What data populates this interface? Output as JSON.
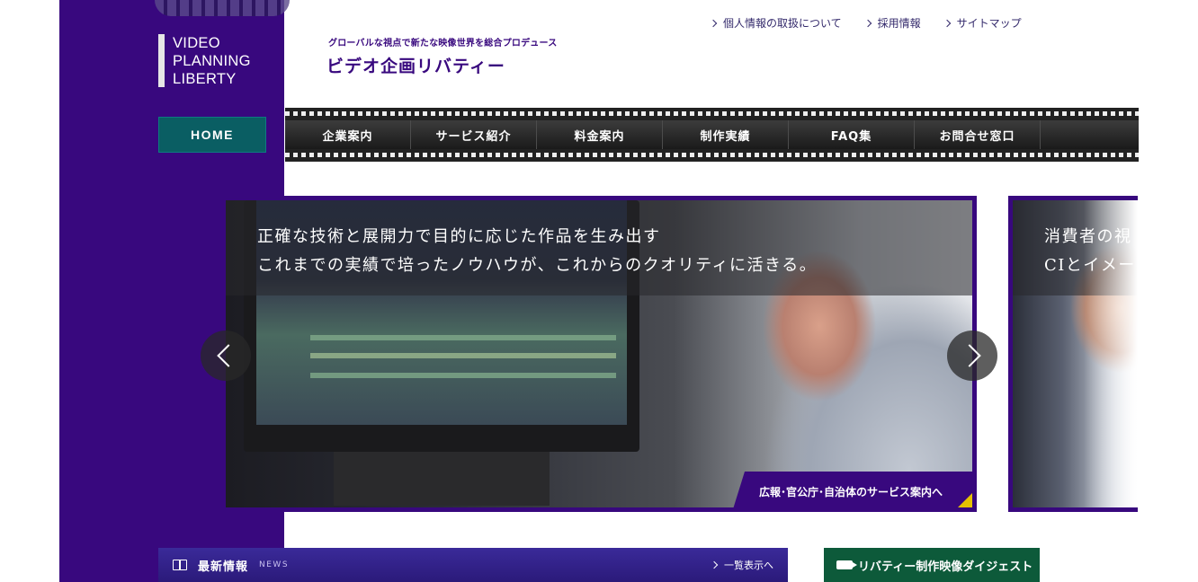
{
  "brand": {
    "logo_lines": [
      "VIDEO",
      "PLANNING",
      "LIBERTY"
    ],
    "tagline": "グローバルな視点で新たな映像世界を総合プロデュース",
    "site_name": "ビデオ企画リバティー"
  },
  "top_links": [
    "個人情報の取扱について",
    "採用情報",
    "サイトマップ"
  ],
  "home_label": "HOME",
  "nav": [
    "企業案内",
    "サービス紹介",
    "料金案内",
    "制作実績",
    "FAQ集",
    "お問合せ窓口"
  ],
  "slider": {
    "main": {
      "line1": "正確な技術と展開力で目的に応じた作品を生み出す",
      "line2": "これまでの実績で培ったノウハウが、これからのクオリティに活きる。",
      "link": "広報･官公庁･自治体のサービス案内へ"
    },
    "next": {
      "line1": "消費者の視",
      "line2": "CIとイメー"
    }
  },
  "news": {
    "title": "最新情報",
    "sub": "NEWS",
    "all": "一覧表示へ"
  },
  "digest": "リバティー制作映像ダイジェスト",
  "colors": {
    "brand_purple": "#38087e",
    "home_teal": "#0a5e63",
    "digest_green": "#0d5a3a",
    "accent_yellow": "#e5c200"
  }
}
